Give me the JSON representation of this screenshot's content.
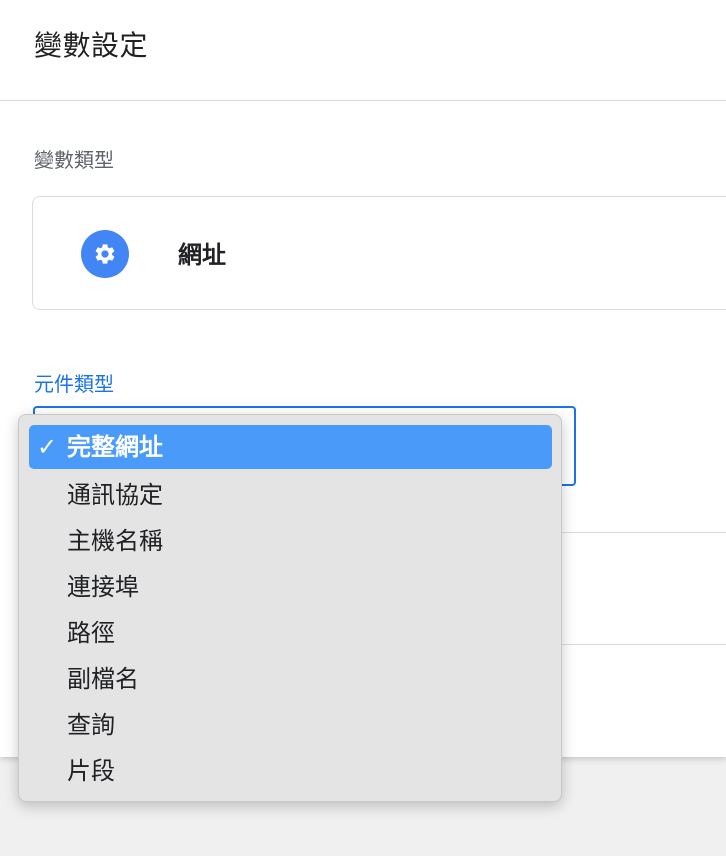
{
  "panel": {
    "title": "變數設定"
  },
  "variable_type": {
    "label": "變數類型",
    "value": "網址",
    "icon": "gear-icon",
    "icon_color": "#4285f4"
  },
  "component_type": {
    "label": "元件類型",
    "selected": "完整網址",
    "options": [
      {
        "label": "完整網址",
        "selected": true
      },
      {
        "label": "通訊協定",
        "selected": false
      },
      {
        "label": "主機名稱",
        "selected": false
      },
      {
        "label": "連接埠",
        "selected": false
      },
      {
        "label": "路徑",
        "selected": false
      },
      {
        "label": "副檔名",
        "selected": false
      },
      {
        "label": "查詢",
        "selected": false
      },
      {
        "label": "片段",
        "selected": false
      }
    ]
  },
  "colors": {
    "accent": "#1a73e8",
    "selected_option_bg": "#4a9bf9",
    "dropdown_bg": "#e4e4e4"
  }
}
